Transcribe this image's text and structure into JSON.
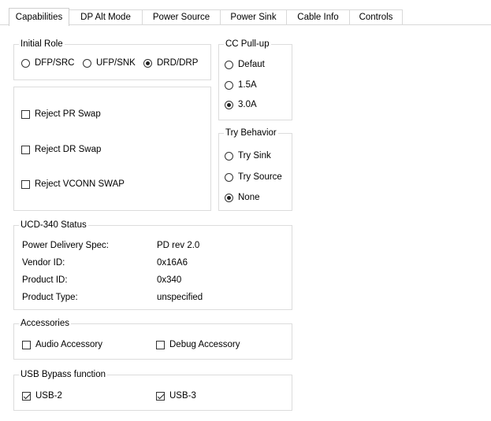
{
  "tabs": [
    {
      "label": "Capabilities",
      "active": true
    },
    {
      "label": "DP Alt Mode",
      "active": false
    },
    {
      "label": "Power Source",
      "active": false
    },
    {
      "label": "Power Sink",
      "active": false
    },
    {
      "label": "Cable Info",
      "active": false
    },
    {
      "label": "Controls",
      "active": false
    }
  ],
  "initial_role": {
    "title": "Initial Role",
    "options": [
      {
        "label": "DFP/SRC",
        "selected": false
      },
      {
        "label": "UFP/SNK",
        "selected": false
      },
      {
        "label": "DRD/DRP",
        "selected": true
      }
    ]
  },
  "cc_pullup": {
    "title": "CC Pull-up",
    "options": [
      {
        "label": "Defaut",
        "selected": false
      },
      {
        "label": "1.5A",
        "selected": false
      },
      {
        "label": "3.0A",
        "selected": true
      }
    ]
  },
  "swaps": [
    {
      "label": "Reject PR Swap",
      "checked": false
    },
    {
      "label": "Reject DR Swap",
      "checked": false
    },
    {
      "label": "Reject VCONN SWAP",
      "checked": false
    }
  ],
  "try_behavior": {
    "title": "Try Behavior",
    "options": [
      {
        "label": "Try Sink",
        "selected": false
      },
      {
        "label": "Try Source",
        "selected": false
      },
      {
        "label": "None",
        "selected": true
      }
    ]
  },
  "status": {
    "title": "UCD-340 Status",
    "rows": [
      {
        "label": "Power Delivery Spec:",
        "value": "PD rev 2.0"
      },
      {
        "label": "Vendor ID:",
        "value": "0x16A6"
      },
      {
        "label": "Product ID:",
        "value": "0x340"
      },
      {
        "label": "Product Type:",
        "value": "unspecified"
      }
    ]
  },
  "accessories": {
    "title": "Accessories",
    "items": [
      {
        "label": "Audio Accessory",
        "checked": false
      },
      {
        "label": "Debug Accessory",
        "checked": false
      }
    ]
  },
  "bypass": {
    "title": "USB Bypass function",
    "items": [
      {
        "label": "USB-2",
        "checked": true
      },
      {
        "label": "USB-3",
        "checked": true
      }
    ]
  }
}
